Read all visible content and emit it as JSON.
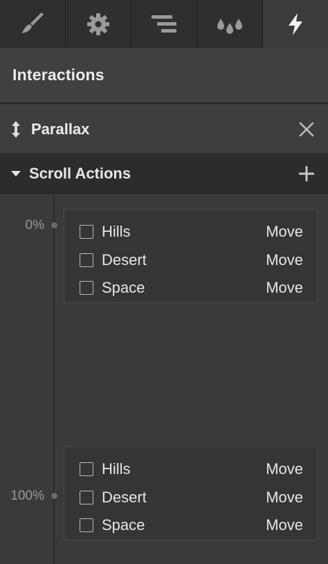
{
  "tabs": [
    {
      "name": "brush-icon"
    },
    {
      "name": "gear-icon"
    },
    {
      "name": "align-icon"
    },
    {
      "name": "drops-icon"
    },
    {
      "name": "lightning-icon",
      "active": true
    }
  ],
  "header": {
    "title": "Interactions"
  },
  "trigger": {
    "label": "Parallax"
  },
  "scroll_actions": {
    "label": "Scroll Actions"
  },
  "timeline": [
    {
      "percent": "0%",
      "items": [
        {
          "name": "Hills",
          "action": "Move"
        },
        {
          "name": "Desert",
          "action": "Move"
        },
        {
          "name": "Space",
          "action": "Move"
        }
      ]
    },
    {
      "percent": "100%",
      "items": [
        {
          "name": "Hills",
          "action": "Move"
        },
        {
          "name": "Desert",
          "action": "Move"
        },
        {
          "name": "Space",
          "action": "Move"
        }
      ]
    }
  ],
  "colors": {
    "background": "#393939",
    "tabbar": "#2b2b2b",
    "text": "#e6e6e6",
    "muted": "#9a9a9a"
  }
}
